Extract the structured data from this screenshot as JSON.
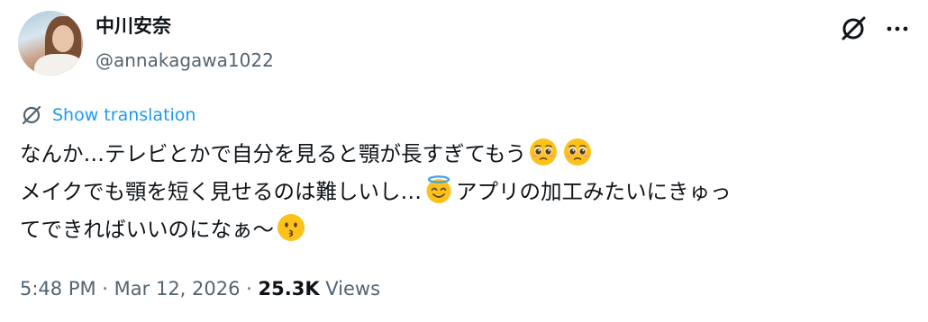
{
  "author": {
    "display_name": "中川安奈",
    "handle": "@annakagawa1022"
  },
  "header_icons": [
    "grok-icon",
    "more-options-icon"
  ],
  "translate": {
    "icon": "translate-icon",
    "label": "Show translation"
  },
  "tweet": {
    "lines": [
      [
        {
          "type": "text",
          "value": "なんか…テレビとかで自分を見ると顎が長すぎてもう"
        },
        {
          "type": "emoji",
          "name": "pleading-face"
        },
        {
          "type": "emoji",
          "name": "pleading-face"
        }
      ],
      [
        {
          "type": "text",
          "value": "メイクでも顎を短く見せるのは難しいし…"
        },
        {
          "type": "emoji",
          "name": "smiling-face-with-halo"
        },
        {
          "type": "text",
          "value": "アプリの加工みたいにきゅっ"
        }
      ],
      [
        {
          "type": "text",
          "value": "てできればいいのになぁ〜"
        },
        {
          "type": "emoji",
          "name": "kissing-face"
        }
      ]
    ]
  },
  "meta": {
    "time": "5:48 PM",
    "separator": " · ",
    "date": "Mar 12, 2026",
    "views_count": "25.3K",
    "views_label": " Views"
  },
  "colors": {
    "text": "#0f1419",
    "secondary": "#536471",
    "accent": "#1d9bf0",
    "emoji_yellow": "#fcc21b"
  }
}
